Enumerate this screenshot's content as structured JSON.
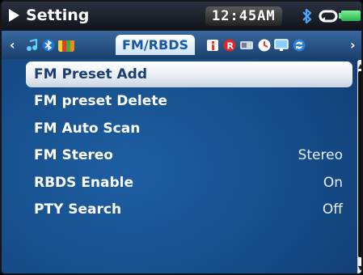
{
  "status_bar": {
    "title": "Setting",
    "time": "12:45AM"
  },
  "tab_bar": {
    "active_tab": "FM/RBDS",
    "icons_left": [
      "music-note-icon",
      "bluetooth-icon",
      "color-bars-icon"
    ],
    "icons_right": [
      "info-icon",
      "record-icon",
      "card-icon",
      "clock-icon",
      "display-icon",
      "sync-icon"
    ]
  },
  "menu": {
    "items": [
      {
        "label": "FM Preset Add",
        "value": "",
        "selected": true
      },
      {
        "label": "FM preset Delete",
        "value": "",
        "selected": false
      },
      {
        "label": "FM Auto Scan",
        "value": "",
        "selected": false
      },
      {
        "label": "FM Stereo",
        "value": "Stereo",
        "selected": false
      },
      {
        "label": "RBDS Enable",
        "value": "On",
        "selected": false
      },
      {
        "label": "PTY Search",
        "value": "Off",
        "selected": false
      }
    ]
  },
  "colors": {
    "background": "#154a85",
    "tab_active_text": "#1658a8",
    "selection": "#ffffff"
  }
}
